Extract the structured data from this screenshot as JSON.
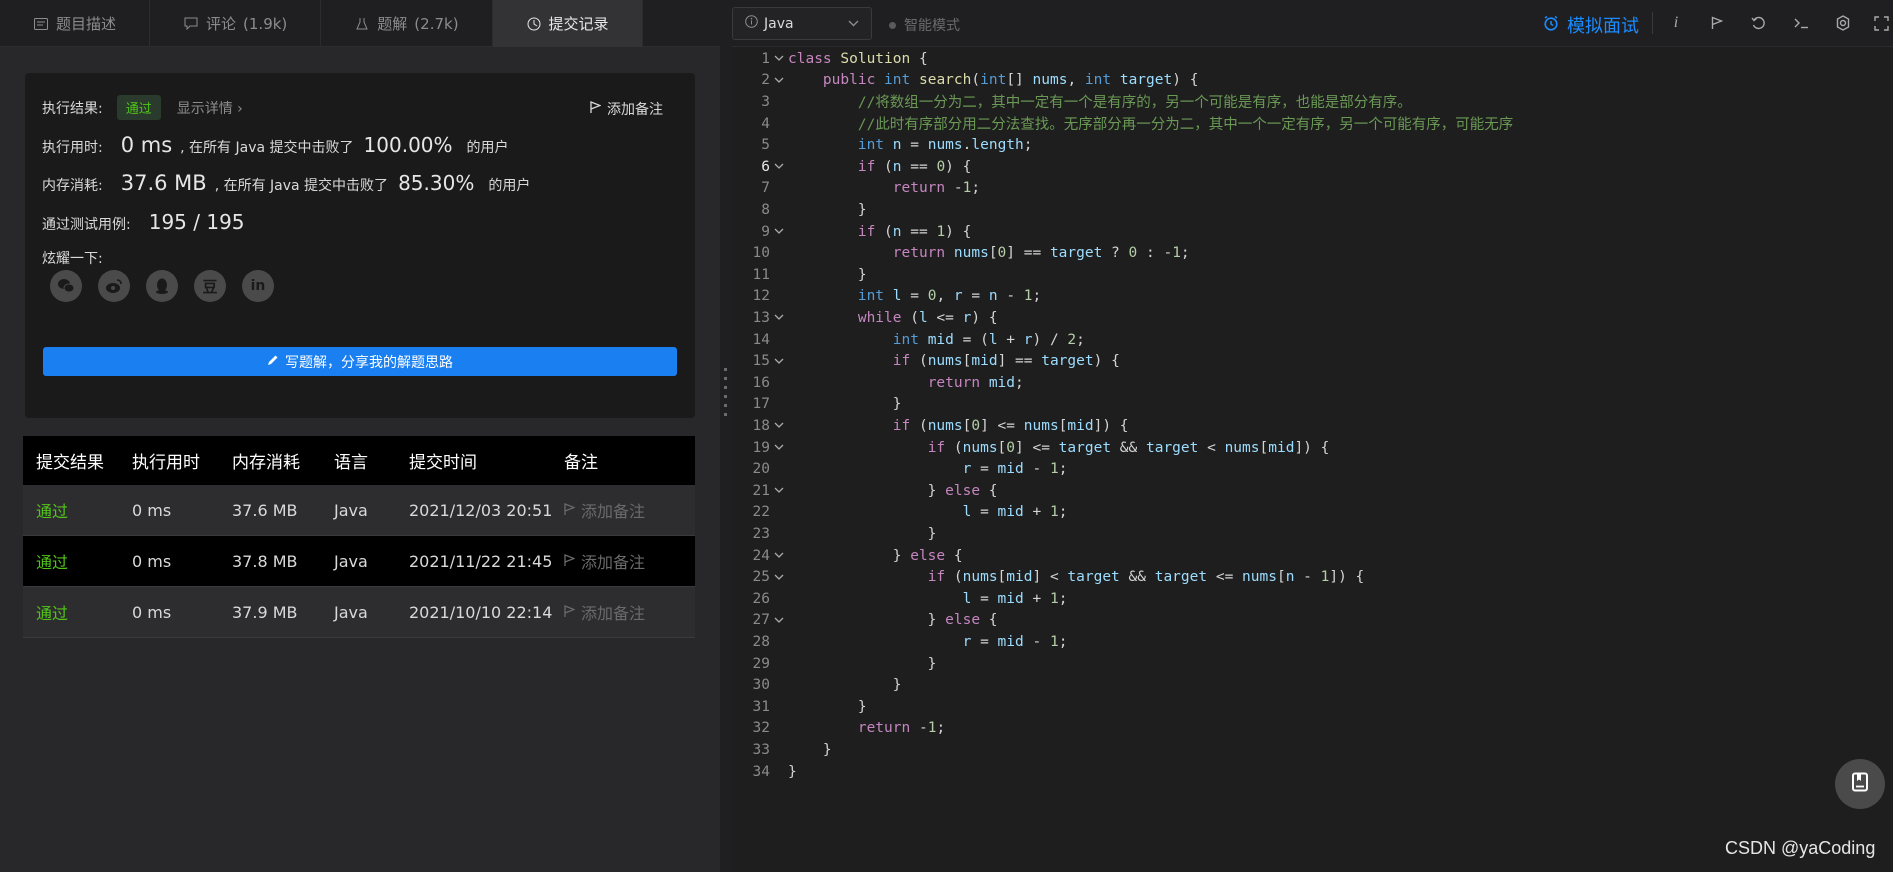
{
  "tabs": [
    {
      "label": "题目描述",
      "count": "",
      "icon": "description-icon"
    },
    {
      "label": "评论",
      "count": "(1.9k)",
      "icon": "comment-icon"
    },
    {
      "label": "题解",
      "count": "(2.7k)",
      "icon": "flask-icon"
    },
    {
      "label": "提交记录",
      "count": "",
      "icon": "clock-icon"
    }
  ],
  "result": {
    "exec_result_label": "执行结果:",
    "status": "通过",
    "show_detail": "显示详情",
    "add_note": "添加备注",
    "time_label": "执行用时:",
    "time_value": "0 ms",
    "time_mid": ", 在所有 Java 提交中击败了",
    "time_pct": "100.00%",
    "time_suffix": "的用户",
    "mem_label": "内存消耗:",
    "mem_value": "37.6 MB",
    "mem_mid": ", 在所有 Java 提交中击败了",
    "mem_pct": "85.30%",
    "mem_suffix": "的用户",
    "tests_label": "通过测试用例:",
    "tests_value": "195 / 195",
    "share_label": "炫耀一下:",
    "share_icons": [
      "wechat-icon",
      "weibo-icon",
      "qq-icon",
      "douban-icon",
      "linkedin-icon"
    ],
    "douban_glyph": "豆",
    "linkedin_glyph": "in",
    "write_button": "写题解，分享我的解题思路"
  },
  "table": {
    "headers": [
      "提交结果",
      "执行用时",
      "内存消耗",
      "语言",
      "提交时间",
      "备注"
    ],
    "rows": [
      {
        "status": "通过",
        "time": "0 ms",
        "mem": "37.6 MB",
        "lang": "Java",
        "date": "2021/12/03 20:51",
        "note": "添加备注"
      },
      {
        "status": "通过",
        "time": "0 ms",
        "mem": "37.8 MB",
        "lang": "Java",
        "date": "2021/11/22 21:45",
        "note": "添加备注"
      },
      {
        "status": "通过",
        "time": "0 ms",
        "mem": "37.9 MB",
        "lang": "Java",
        "date": "2021/10/10 22:14",
        "note": "添加备注"
      }
    ]
  },
  "toolbar": {
    "language": "Java",
    "smart_mode": "智能模式",
    "mock_interview": "模拟面试"
  },
  "code": {
    "lines": [
      "class Solution {",
      "    public int search(int[] nums, int target) {",
      "        //将数组一分为二，其中一定有一个是有序的，另一个可能是有序，也能是部分有序。",
      "        //此时有序部分用二分法查找。无序部分再一分为二，其中一个一定有序，另一个可能有序，可能无序",
      "        int n = nums.length;",
      "        if (n == 0) {",
      "            return -1;",
      "        }",
      "        if (n == 1) {",
      "            return nums[0] == target ? 0 : -1;",
      "        }",
      "        int l = 0, r = n - 1;",
      "        while (l <= r) {",
      "            int mid = (l + r) / 2;",
      "            if (nums[mid] == target) {",
      "                return mid;",
      "            }",
      "            if (nums[0] <= nums[mid]) {",
      "                if (nums[0] <= target && target < nums[mid]) {",
      "                    r = mid - 1;",
      "                } else {",
      "                    l = mid + 1;",
      "                }",
      "            } else {",
      "                if (nums[mid] < target && target <= nums[n - 1]) {",
      "                    l = mid + 1;",
      "                } else {",
      "                    r = mid - 1;",
      "                }",
      "            }",
      "        }",
      "        return -1;",
      "    }",
      "}"
    ],
    "fold_lines": [
      1,
      2,
      6,
      9,
      13,
      15,
      18,
      19,
      21,
      24,
      25,
      27
    ],
    "active_line": 6
  },
  "watermark": "CSDN @yaCoding",
  "colors": {
    "accent": "#1a7ff0",
    "pass": "#52c41a",
    "interview": "#1a8cff"
  }
}
